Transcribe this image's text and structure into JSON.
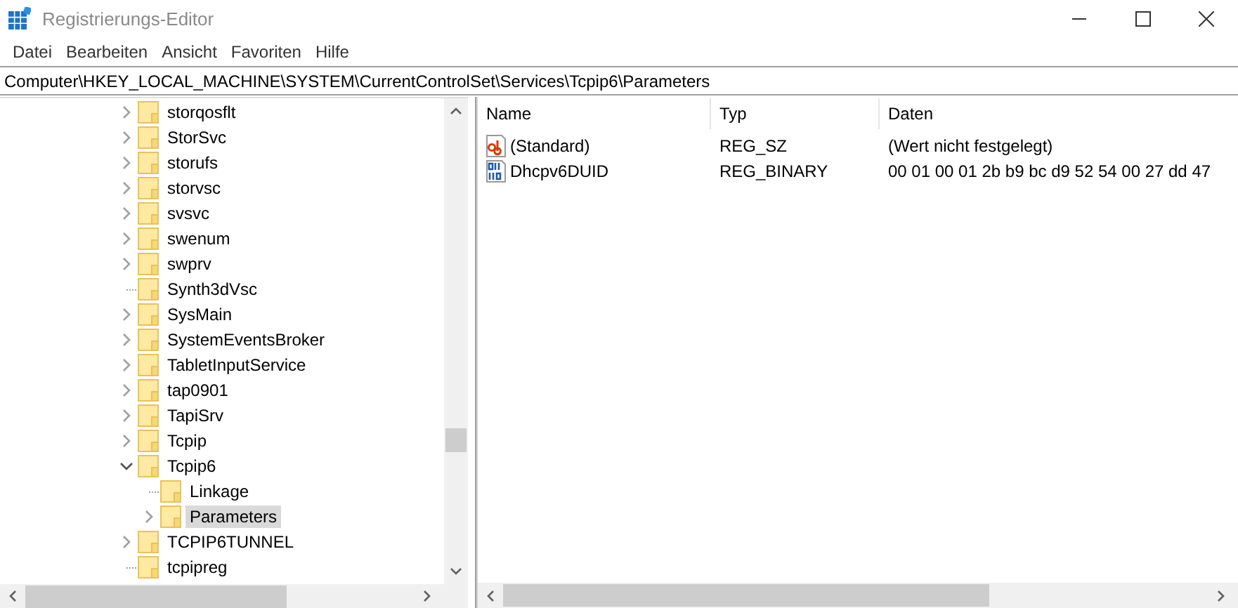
{
  "window": {
    "title": "Registrierungs-Editor"
  },
  "menu": [
    "Datei",
    "Bearbeiten",
    "Ansicht",
    "Favoriten",
    "Hilfe"
  ],
  "address": "Computer\\HKEY_LOCAL_MACHINE\\SYSTEM\\CurrentControlSet\\Services\\Tcpip6\\Parameters",
  "tree": [
    {
      "label": "storqosflt",
      "expandable": true,
      "expanded": false,
      "selected": false
    },
    {
      "label": "StorSvc",
      "expandable": true,
      "expanded": false,
      "selected": false
    },
    {
      "label": "storufs",
      "expandable": true,
      "expanded": false,
      "selected": false
    },
    {
      "label": "storvsc",
      "expandable": true,
      "expanded": false,
      "selected": false
    },
    {
      "label": "svsvc",
      "expandable": true,
      "expanded": false,
      "selected": false
    },
    {
      "label": "swenum",
      "expandable": true,
      "expanded": false,
      "selected": false
    },
    {
      "label": "swprv",
      "expandable": true,
      "expanded": false,
      "selected": false
    },
    {
      "label": "Synth3dVsc",
      "expandable": false,
      "selected": false
    },
    {
      "label": "SysMain",
      "expandable": true,
      "expanded": false,
      "selected": false
    },
    {
      "label": "SystemEventsBroker",
      "expandable": true,
      "expanded": false,
      "selected": false
    },
    {
      "label": "TabletInputService",
      "expandable": true,
      "expanded": false,
      "selected": false
    },
    {
      "label": "tap0901",
      "expandable": true,
      "expanded": false,
      "selected": false
    },
    {
      "label": "TapiSrv",
      "expandable": true,
      "expanded": false,
      "selected": false
    },
    {
      "label": "Tcpip",
      "expandable": true,
      "expanded": false,
      "selected": false
    },
    {
      "label": "Tcpip6",
      "expandable": true,
      "expanded": true,
      "selected": false,
      "children": [
        {
          "label": "Linkage",
          "expandable": false,
          "selected": false
        },
        {
          "label": "Parameters",
          "expandable": true,
          "expanded": false,
          "selected": true
        }
      ]
    },
    {
      "label": "TCPIP6TUNNEL",
      "expandable": true,
      "expanded": false,
      "selected": false
    },
    {
      "label": "tcpipreg",
      "expandable": false,
      "selected": false
    }
  ],
  "values": {
    "columns": [
      "Name",
      "Typ",
      "Daten"
    ],
    "rows": [
      {
        "kind": "string",
        "name": "(Standard)",
        "type": "REG_SZ",
        "data": "(Wert nicht festgelegt)"
      },
      {
        "kind": "binary",
        "name": "Dhcpv6DUID",
        "type": "REG_BINARY",
        "data": "00 01 00 01 2b b9 bc d9 52 54 00 27 dd 47"
      }
    ]
  }
}
